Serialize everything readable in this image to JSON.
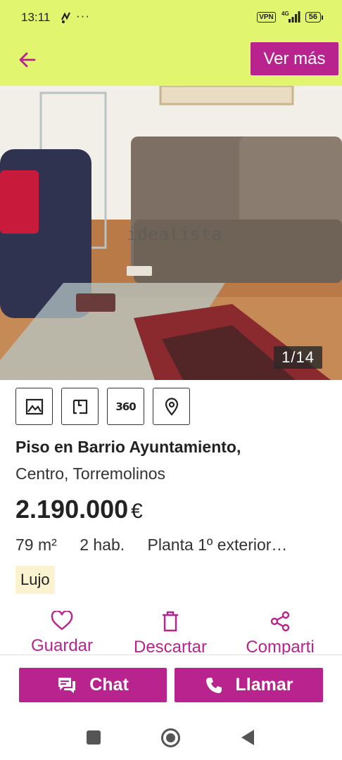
{
  "status_bar": {
    "time": "13:11",
    "dots": "···",
    "vpn": "VPN",
    "network": "4G",
    "battery": "56"
  },
  "app_bar": {
    "ver_mas_label": "Ver más"
  },
  "gallery": {
    "counter": "1/14",
    "watermark": "idealista"
  },
  "media_buttons": {
    "tour_label": "360"
  },
  "listing": {
    "title_line1": "Piso en Barrio Ayuntamiento,",
    "title_line2": "Centro, Torremolinos",
    "price": "2.190.000",
    "currency": "€",
    "features": [
      "79 m²",
      "2 hab.",
      "Planta 1º exterior…"
    ],
    "tag": "Lujo"
  },
  "actions": {
    "save": "Guardar",
    "discard": "Descartar",
    "share": "Comparti"
  },
  "bottom_buttons": {
    "chat": "Chat",
    "call": "Llamar"
  },
  "colors": {
    "accent": "#b9238e",
    "header": "#e1f56f",
    "tag_bg": "#fbf3d0"
  }
}
